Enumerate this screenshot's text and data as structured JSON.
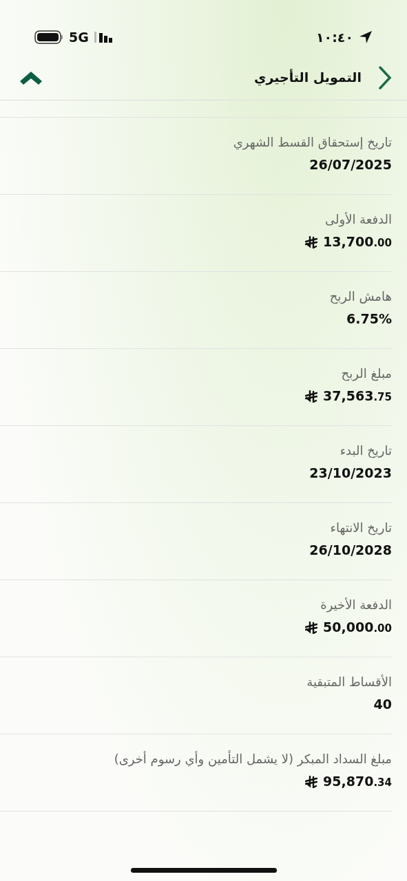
{
  "status_bar": {
    "time": "١٠:٤٠",
    "network": "5G"
  },
  "header": {
    "title": "التمويل التأجيري"
  },
  "rows": [
    {
      "label": "تاريخ إستحقاق القسط الشهري",
      "kind": "text",
      "value": "26/07/2025"
    },
    {
      "label": "الدفعة الأولى",
      "kind": "money",
      "value": "13,700",
      "fraction": ".00"
    },
    {
      "label": "هامش الربح",
      "kind": "text",
      "value": "6.75%"
    },
    {
      "label": "مبلغ الربح",
      "kind": "money",
      "value": "37,563",
      "fraction": ".75"
    },
    {
      "label": "تاريخ البدء",
      "kind": "text",
      "value": "23/10/2023"
    },
    {
      "label": "تاريخ الانتهاء",
      "kind": "text",
      "value": "26/10/2028"
    },
    {
      "label": "الدفعة الأخيرة",
      "kind": "money",
      "value": "50,000",
      "fraction": ".00"
    },
    {
      "label": "الأقساط المتبقية",
      "kind": "text",
      "value": "40"
    },
    {
      "label": "مبلغ السداد المبكر (لا يشمل التأمين وأي رسوم أخرى)",
      "kind": "money",
      "value": "95,870",
      "fraction": ".34"
    }
  ]
}
